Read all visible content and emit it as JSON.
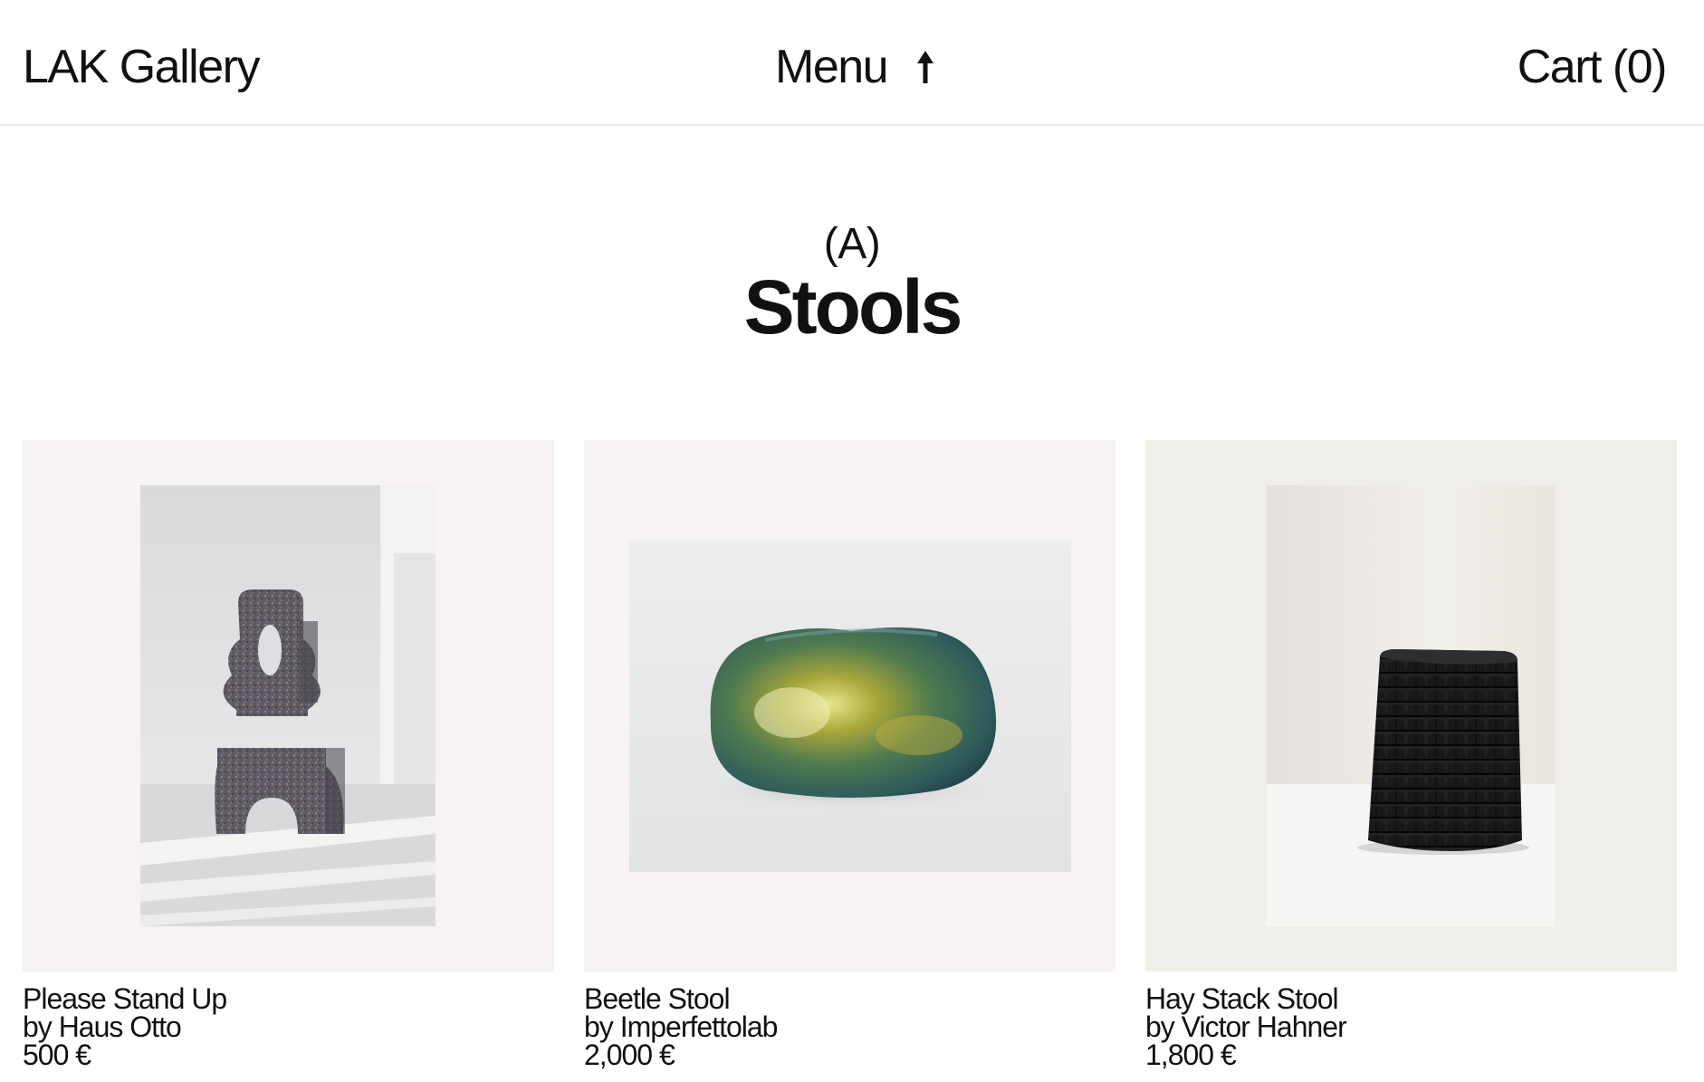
{
  "header": {
    "logo": "LAK Gallery",
    "menu_label": "Menu",
    "menu_icon": "arrow-up-icon",
    "cart_label": "Cart (0)"
  },
  "section": {
    "letter": "(A)",
    "title": "Stools"
  },
  "products": [
    {
      "name": "Please Stand Up",
      "designer": "by Haus Otto",
      "price": "500 €",
      "frame_color": "#f7f3f2",
      "image": "stacked-stool-photo"
    },
    {
      "name": "Beetle Stool",
      "designer": "by Imperfettolab",
      "price": "2,000 €",
      "frame_color": "#f7f3f2",
      "image": "iridescent-stool-photo"
    },
    {
      "name": "Hay Stack Stool",
      "designer": "by Victor Hahner",
      "price": "1,800 €",
      "frame_color": "#efeee8",
      "image": "black-shingle-stool-photo"
    }
  ]
}
